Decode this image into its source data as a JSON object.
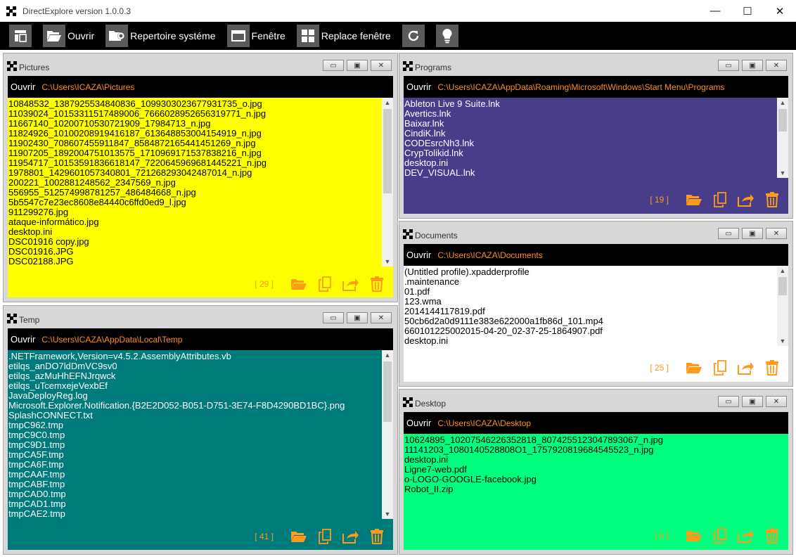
{
  "window": {
    "title": "DirectExplore version 1.0.0.3",
    "minimize": "—",
    "maximize": "☐",
    "close": "✕"
  },
  "toolbar": {
    "open": "Ouvrir",
    "system_dir": "Repertoire systéme",
    "window": "Fenêtre",
    "replace_window": "Replace fenêtre"
  },
  "colors": {
    "accent": "#ff8c1a",
    "pictures": "#ffff00",
    "programs": "#473d8b",
    "documents": "#ffffff",
    "temp": "#007b7b",
    "desktop": "#00ff7f"
  },
  "panels": {
    "pictures": {
      "title": "Pictures",
      "open_label": "Ouvrir",
      "path": "C:\\Users\\ICAZA\\Pictures",
      "count": "[ 29 ]",
      "files": [
        "10848532_1387925534840836_1099303023677931735_o.jpg",
        "11039024_10153311517489006_7666028952656319771_n.jpg",
        "11667140_10200710530721909_17984713_n.jpg",
        "11824926_10100208919416187_613648853004154919_n.jpg",
        "11902430_708607455911847_8584872165441451269_n.jpg",
        "11907205_1892004751013575_1710969171537838216_n.jpg",
        "11954717_10153591836618147_7220645969681445221_n.jpg",
        "1978801_1429601057340801_721268293042487014_n.jpg",
        "200221_1002881248562_2347569_n.jpg",
        "556955_512574998781257_486484668_n.jpg",
        "5b5547c7e23ec8608e84440c6ffd0ed9_l.jpg",
        "911299276.jpg",
        "ataque-informático.jpg",
        "desktop.ini",
        "DSC01916 copy.jpg",
        "DSC01916.JPG",
        "DSC02188.JPG"
      ]
    },
    "programs": {
      "title": "Programs",
      "open_label": "Ouvrir",
      "path": "C:\\Users\\ICAZA\\AppData\\Roaming\\Microsoft\\Windows\\Start Menu\\Programs",
      "count": "[ 19 ]",
      "files": [
        "Ableton Live 9 Suite.lnk",
        "Avertics.lnk",
        "Baixar.lnk",
        "CindiK.lnk",
        "CODEsrcNh3.lnk",
        "CrypTolikid.lnk",
        "desktop.ini",
        "DEV_VISUAL.lnk"
      ]
    },
    "documents": {
      "title": "Documents",
      "open_label": "Ouvrir",
      "path": "C:\\Users\\ICAZA\\Documents",
      "count": "[ 25 ]",
      "files": [
        "(Untitled profile).xpadderprofile",
        ".maintenance",
        "01.pdf",
        "123.wma",
        "2014144117819.pdf",
        "50cb6d2a0d9111e383e622000a1fb86d_101.mp4",
        "660101225002015-04-20_02-37-25-1864907.pdf",
        "desktop.ini"
      ]
    },
    "temp": {
      "title": "Temp",
      "open_label": "Ouvrir",
      "path": "C:\\Users\\ICAZA\\AppData\\Local\\Temp",
      "count": "[ 41 ]",
      "files": [
        ".NETFramework,Version=v4.5.2.AssemblyAttributes.vb",
        "etilqs_anDO7ldDmVC9sv0",
        "etilqs_azMuHhEFNJrqwck",
        "etilqs_uTcemxejeVexbEf",
        "JavaDeployReg.log",
        "Microsoft.Explorer.Notification.{B2E2D052-B051-D751-3E74-F8D4290BD1BC}.png",
        "SplashCONNECT.txt",
        "tmpC962.tmp",
        "tmpC9C0.tmp",
        "tmpC9D1.tmp",
        "tmpCA5F.tmp",
        "tmpCA6F.tmp",
        "tmpCAAF.tmp",
        "tmpCABF.tmp",
        "tmpCAD0.tmp",
        "tmpCAD1.tmp",
        "tmpCAE2.tmp"
      ]
    },
    "desktop": {
      "title": "Desktop",
      "open_label": "Ouvrir",
      "path": "C:\\Users\\ICAZA\\Desktop",
      "count": "[ 6 ]",
      "files": [
        "10624895_10207546226352818_8074255123047893067_n.jpg",
        "11141203_1080140528808O1_1757920819684545523_n.jpg",
        "desktop.ini",
        "Ligne7-web.pdf",
        "o-LOGO-GOOGLE-facebook.jpg",
        "Robot_II.zip"
      ]
    }
  },
  "panel_ctrls": {
    "minimize": "▭",
    "restore": "▣",
    "close": "✕"
  }
}
